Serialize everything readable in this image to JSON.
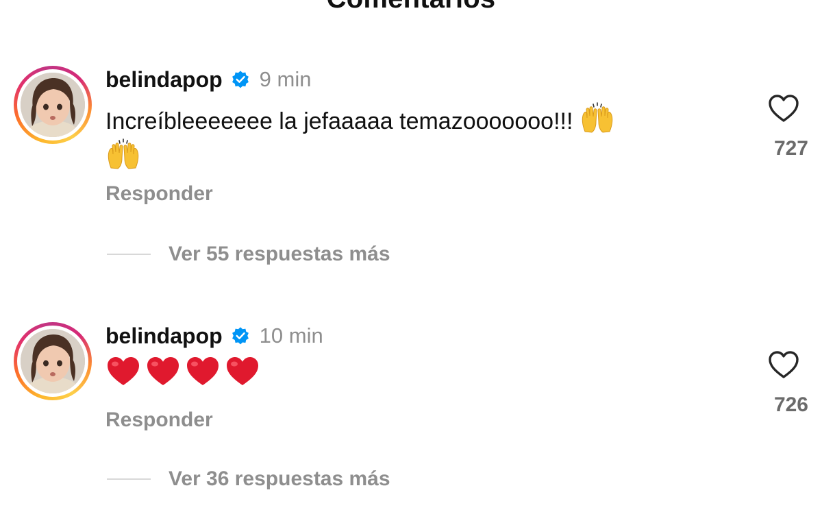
{
  "sheet": {
    "title": "Comentarios"
  },
  "comments": [
    {
      "username": "belindapop",
      "verified": true,
      "time": "9 min",
      "text": "Increíbleeeeeee la jefaaaaa temazooooooo!!!",
      "emojis": [
        "raising-hands",
        "raising-hands"
      ],
      "reply_label": "Responder",
      "likes": "727",
      "view_replies": "Ver 55 respuestas más"
    },
    {
      "username": "belindapop",
      "verified": true,
      "time": "10 min",
      "text": "",
      "emojis": [
        "red-heart",
        "red-heart",
        "red-heart",
        "red-heart"
      ],
      "reply_label": "Responder",
      "likes": "726",
      "view_replies": "Ver 36 respuestas más"
    }
  ],
  "colors": {
    "verified_badge": "#0095f6",
    "secondary_text": "#8e8e8e",
    "heart_emoji": "#e0192e",
    "raising_hands_emoji": "#f7c133"
  }
}
